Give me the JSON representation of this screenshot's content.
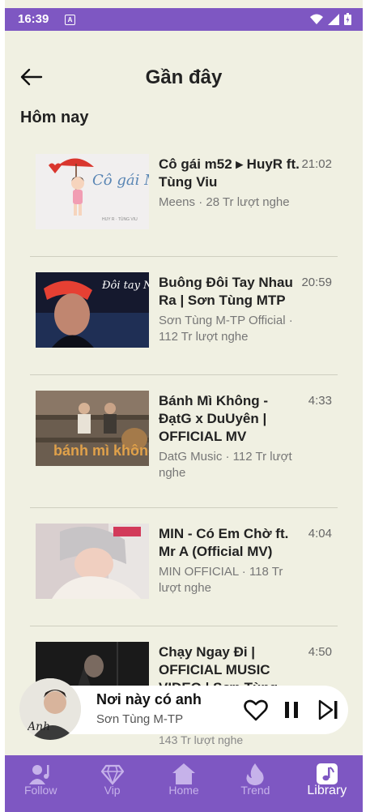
{
  "status": {
    "time": "16:39",
    "notif": "A"
  },
  "header": {
    "title": "Gần đây"
  },
  "section": {
    "label": "Hôm nay"
  },
  "items": [
    {
      "title": "Cô gái m52 ▸ HuyR ft. Tùng Viu",
      "meta": "Meens · 28 Tr lượt nghe",
      "duration": "21:02",
      "thumb_text": "Cô gái M52"
    },
    {
      "title": "Buông Đôi Tay Nhau Ra | Sơn Tùng MTP",
      "meta": "Sơn Tùng M-TP Official · 112 Tr lượt nghe",
      "duration": "20:59",
      "thumb_text": "Đôi tay NHAU RA"
    },
    {
      "title": "Bánh Mì Không - ĐạtG x DuUyên | OFFICIAL MV",
      "meta": "DatG Music · 112 Tr lượt nghe",
      "duration": "4:33",
      "thumb_text": "bánh mì không"
    },
    {
      "title": "MIN - Có Em Chờ ft. Mr A (Official MV)",
      "meta": "MIN OFFICIAL · 118 Tr lượt nghe",
      "duration": "4:04",
      "thumb_text": ""
    },
    {
      "title": "Chạy Ngay Đi | OFFICIAL MUSIC VIDEO | Sơn Tùng",
      "meta": "143 Tr lượt nghe",
      "duration": "4:50",
      "thumb_text": ""
    }
  ],
  "player": {
    "title": "Nơi này có anh",
    "artist": "Sơn Tùng M-TP",
    "art_text": "Anh"
  },
  "nav": [
    {
      "label": "Follow",
      "icon": "person-music-icon"
    },
    {
      "label": "Vip",
      "icon": "diamond-icon"
    },
    {
      "label": "Home",
      "icon": "home-icon"
    },
    {
      "label": "Trend",
      "icon": "flame-icon"
    },
    {
      "label": "Library",
      "icon": "music-note-icon",
      "active": true
    }
  ],
  "colors": {
    "accent": "#7e57c2",
    "background": "#f0f0e2"
  }
}
